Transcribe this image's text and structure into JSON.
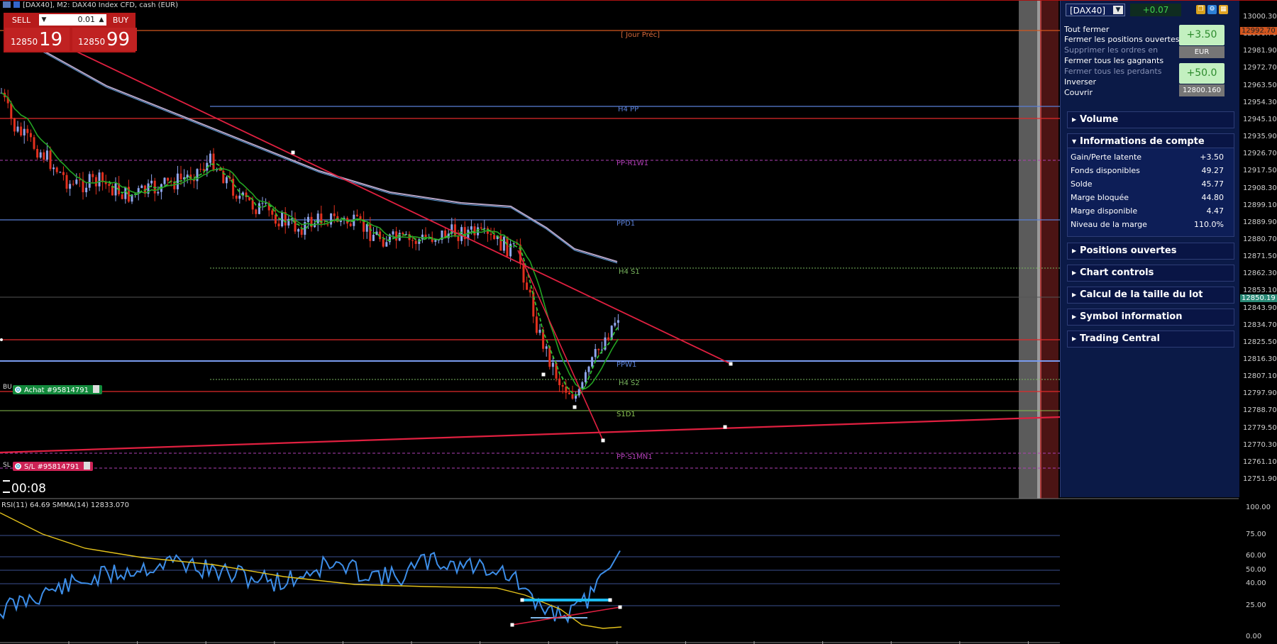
{
  "window": {
    "title": "[DAX40], M2:  DAX40 Index CFD, cash (EUR)"
  },
  "trade_panel": {
    "sell_label": "SELL",
    "buy_label": "BUY",
    "lot_value": "0.01",
    "sell_prefix": "12850",
    "sell_big": "19",
    "buy_prefix": "12850",
    "buy_big": "99"
  },
  "levels": [
    {
      "label": "[ Jour Préc]",
      "color": "#d86a3b"
    },
    {
      "label": "H4 PP",
      "color": "#5a7fd6"
    },
    {
      "label": "PP-R1W1",
      "color": "#b13fb6"
    },
    {
      "label": "PPD1",
      "color": "#5a7fd6"
    },
    {
      "label": "H4 S1",
      "color": "#7ab85f"
    },
    {
      "label": "PPW1",
      "color": "#5a7fd6"
    },
    {
      "label": "H4 S2",
      "color": "#7ab85f"
    },
    {
      "label": "S1D1",
      "color": "#88c050"
    },
    {
      "label": "PP-S1MN1",
      "color": "#b13fb6"
    }
  ],
  "order_tags": {
    "buy_side": "BU",
    "buy_tag": "Achat #95814791",
    "sl_side": "SL",
    "sl_tag": "S/L #95814791"
  },
  "timer": "00:08",
  "rsi": {
    "title": "RSI(11) 64.69 SMMA(14) 12833.070",
    "axis": [
      "100.00",
      "75.00",
      "60.00",
      "50.00",
      "40.00",
      "25.00",
      "0.00"
    ]
  },
  "price_axis": [
    "13000.30",
    "12990.70",
    "12981.90",
    "12972.70",
    "12963.50",
    "12954.30",
    "12945.10",
    "12935.90",
    "12926.70",
    "12917.50",
    "12908.30",
    "12899.10",
    "12889.90",
    "12880.70",
    "12871.50",
    "12862.30",
    "12853.10",
    "12843.90",
    "12834.70",
    "12825.50",
    "12816.30",
    "12807.10",
    "12797.90",
    "12788.70",
    "12779.50",
    "12770.30",
    "12761.10",
    "12751.90"
  ],
  "price_tags": {
    "prev_close": "12992.70",
    "current": "12850.19"
  },
  "panel": {
    "symbol": "[DAX40]",
    "pnl": "+0.07",
    "actions": {
      "close_all": "Tout fermer",
      "close_open": "Fermer les positions ouvertes",
      "delete_orders": "Supprimer les ordres en",
      "close_winners": "Fermer tous les gagnants",
      "close_losers": "Fermer tous les perdants",
      "reverse": "Inverser",
      "hedge": "Couvrir"
    },
    "box1_value": "+3.50",
    "box1_sub": "EUR",
    "box2_value": "+50.0",
    "box2_sub": "12800.160",
    "sections": {
      "volume": "Volume",
      "account": "Informations de compte",
      "positions": "Positions ouvertes",
      "chart_controls": "Chart controls",
      "lot_calc": "Calcul de la taille du lot",
      "symbol_info": "Symbol information",
      "trading_central": "Trading Central"
    },
    "account": [
      {
        "k": "Gain/Perte latente",
        "v": "+3.50"
      },
      {
        "k": "Fonds disponibles",
        "v": "49.27"
      },
      {
        "k": "Solde",
        "v": "45.77"
      },
      {
        "k": "Marge bloquée",
        "v": "44.80"
      },
      {
        "k": "Marge disponible",
        "v": "4.47"
      },
      {
        "k": "Niveau de la marge",
        "v": "110.0%"
      }
    ]
  },
  "colors": {
    "bull": "#8fa6ee",
    "bear": "#e2301e",
    "sma_green": "#23a323",
    "ma_slow": "#b8a6c8",
    "trend_red": "#e02040",
    "rsi": "#3d8ee8",
    "smma": "#e4c21b"
  }
}
